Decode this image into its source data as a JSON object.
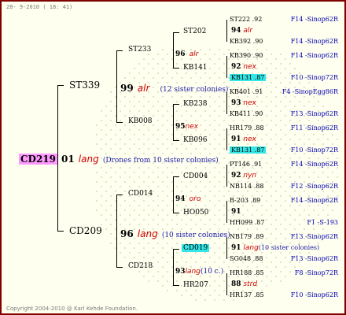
{
  "header": "28- 9-2010 ( 18: 41)",
  "footer": "Copyright 2004-2010 @ Karl Kehde Foundation.",
  "colors": {
    "border": "#800000",
    "highlight": "#33e6e6",
    "root_highlight": "#ff99ff",
    "code": "#0000b0",
    "race": "#cc0000"
  },
  "root": {
    "id": "CD219",
    "num": "01",
    "race": "lang",
    "note": "(Drones from 10 sister colonies)"
  },
  "gen1": [
    {
      "id": "ST339",
      "num": "99",
      "race": "alr",
      "note": "(12 sister colonies)"
    },
    {
      "id": "CD209",
      "num": "96",
      "race": "lang",
      "note": "(10 sister colonies)"
    }
  ],
  "gen2": [
    {
      "id": "ST233",
      "num": "96",
      "race": "alr"
    },
    {
      "id": "KB008",
      "num": "95",
      "race": "nex"
    },
    {
      "id": "CD014",
      "num": "94",
      "race": "oro"
    },
    {
      "id": "CD218",
      "num": "93",
      "race": "lang",
      "note": "(10 c.)"
    }
  ],
  "gen3": [
    {
      "id": "ST202",
      "num": "94",
      "race": "alr"
    },
    {
      "id": "KB141",
      "num": "92",
      "race": "nex"
    },
    {
      "id": "KB238",
      "num": "93",
      "race": "nex"
    },
    {
      "id": "KB096",
      "num": "91",
      "race": "nex"
    },
    {
      "id": "CD004",
      "num": "92",
      "race": "nyn"
    },
    {
      "id": "HO050",
      "num": "91",
      "race": ""
    },
    {
      "id": "CD019",
      "num": "91",
      "race": "lang",
      "note": "(10 sister colonies)"
    },
    {
      "id": "HR207",
      "num": "88",
      "race": "strd"
    }
  ],
  "gen4": [
    {
      "id": "ST222",
      "yr": ".92",
      "code": "F14 -Sinop62R"
    },
    {
      "id": "KB392",
      "yr": ".90",
      "code": "F14 -Sinop62R"
    },
    {
      "id": "KB390",
      "yr": ".90",
      "code": "F14 -Sinop62R"
    },
    {
      "id": "KB131",
      "yr": ".87",
      "code": "F10 -Sinop72R"
    },
    {
      "id": "KB401",
      "yr": ".91",
      "code": "F4 -SinopEgg86R"
    },
    {
      "id": "KB411",
      "yr": ".90",
      "code": "F13 -Sinop62R"
    },
    {
      "id": "HR179",
      "yr": ".88",
      "code": "F11 -Sinop62R"
    },
    {
      "id": "KB131",
      "yr": ".87",
      "code": "F10 -Sinop72R"
    },
    {
      "id": "PT146",
      "yr": ".91",
      "code": "F14 -Sinop62R"
    },
    {
      "id": "NB114",
      "yr": ".88",
      "code": "F12 -Sinop62R"
    },
    {
      "id": "B-203",
      "yr": ".89",
      "code": "F14 -Sinop62R"
    },
    {
      "id": "HH099",
      "yr": ".87",
      "code": "F1 -S-193"
    },
    {
      "id": "NB179",
      "yr": ".89",
      "code": "F13 -Sinop62R"
    },
    {
      "id": "SG048",
      "yr": ".88",
      "code": "F13 -Sinop62R"
    },
    {
      "id": "HR188",
      "yr": ".85",
      "code": "F8 -Sinop72R"
    },
    {
      "id": "HR137",
      "yr": ".85",
      "code": "F10 -Sinop62R"
    }
  ]
}
